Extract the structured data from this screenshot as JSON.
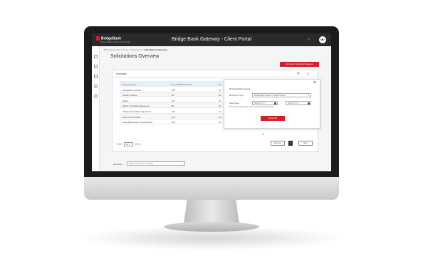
{
  "header": {
    "brand": "BridgeBank",
    "brand_sub": "Western Alliance Bank. Member FDIC.",
    "portal_title": "Bridge Bank Gateway - Client Portal",
    "user_initials": "MD"
  },
  "breadcrumb": {
    "path": "BB Gateway Client Portal > Solicitations > ",
    "current": "Solicitations Overview"
  },
  "page": {
    "title": "Solicitations Overview",
    "request_button": "Document Solicitation Request"
  },
  "card": {
    "title": "Overview"
  },
  "table": {
    "headers": [
      "Document Type",
      "No. of Total Documents",
      "No."
    ],
    "rows": [
      [
        "Stockholder Consent",
        "100",
        "10"
      ],
      [
        "Joinder Consent",
        "50",
        "50"
      ],
      [
        "Waiver",
        "115",
        "15"
      ],
      [
        "Option Termination Agreement",
        "80",
        "10"
      ],
      [
        "Warrant Cancelation Agreement",
        "100",
        "10"
      ],
      [
        "Letter of Transmittal",
        "140",
        "10"
      ],
      [
        "Accredited Investor Questionnaire",
        "100",
        "10"
      ]
    ],
    "extra_value": "70"
  },
  "pagination": {
    "show_label": "Show",
    "show_value": "10",
    "entries_label": "entries",
    "prev": "Previous",
    "page": "1",
    "next": "Next"
  },
  "modal": {
    "title": "Download Documents",
    "doc_type_label": "Document Type",
    "doc_type_value": "Stockholder Consent, Joinder Consent",
    "date_label": "Date range",
    "date_from": "MM/DD/YYYY",
    "date_to": "MM/DD/YYYY",
    "note": "Enter Date range to capture one or any registered documents",
    "download_button": "Download"
  },
  "accounts": {
    "label": "Accounts",
    "placeholder": "Select an Account / Company"
  },
  "colors": {
    "accent": "#d11f2f",
    "header_bg": "#2a2a2c",
    "link_blue": "#2f62ad"
  }
}
